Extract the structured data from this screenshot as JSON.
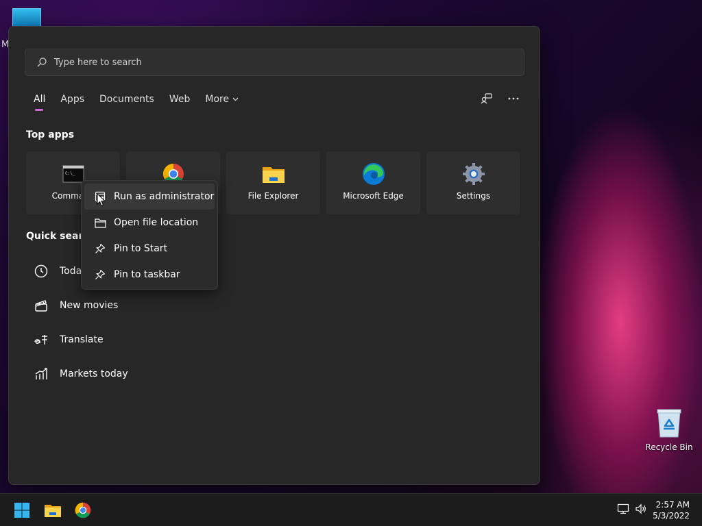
{
  "desktop": {
    "partial_icon_letter": "M",
    "recycle_bin_label": "Recycle Bin"
  },
  "search": {
    "placeholder": "Type here to search"
  },
  "tabs": [
    {
      "label": "All",
      "active": true
    },
    {
      "label": "Apps"
    },
    {
      "label": "Documents"
    },
    {
      "label": "Web"
    },
    {
      "label": "More"
    }
  ],
  "sections": {
    "top_apps": "Top apps",
    "quick_searches": "Quick search"
  },
  "top_apps": [
    {
      "label": "Command",
      "icon": "command-prompt-icon"
    },
    {
      "label": "",
      "icon": "chrome-icon"
    },
    {
      "label": "File Explorer",
      "icon": "folder-icon"
    },
    {
      "label": "Microsoft Edge",
      "icon": "edge-icon"
    },
    {
      "label": "Settings",
      "icon": "gear-icon"
    }
  ],
  "quick_searches": [
    {
      "label": "Toda",
      "icon": "clock-icon"
    },
    {
      "label": "New movies",
      "icon": "clapperboard-icon"
    },
    {
      "label": "Translate",
      "icon": "translate-icon"
    },
    {
      "label": "Markets today",
      "icon": "chart-icon"
    }
  ],
  "context_menu": [
    {
      "label": "Run as administrator",
      "icon": "shield-window-icon",
      "hovered": true
    },
    {
      "label": "Open file location",
      "icon": "folder-outline-icon"
    },
    {
      "label": "Pin to Start",
      "icon": "pin-icon"
    },
    {
      "label": "Pin to taskbar",
      "icon": "pin-icon"
    }
  ],
  "taskbar": {
    "time": "2:57 AM",
    "date": "5/3/2022",
    "icons": [
      "windows-start-icon",
      "file-explorer-icon",
      "chrome-icon"
    ]
  },
  "colors": {
    "accent_indicator": "#d16ad8",
    "panel_bg": "#272727",
    "tile_bg": "#2e2e2e"
  }
}
